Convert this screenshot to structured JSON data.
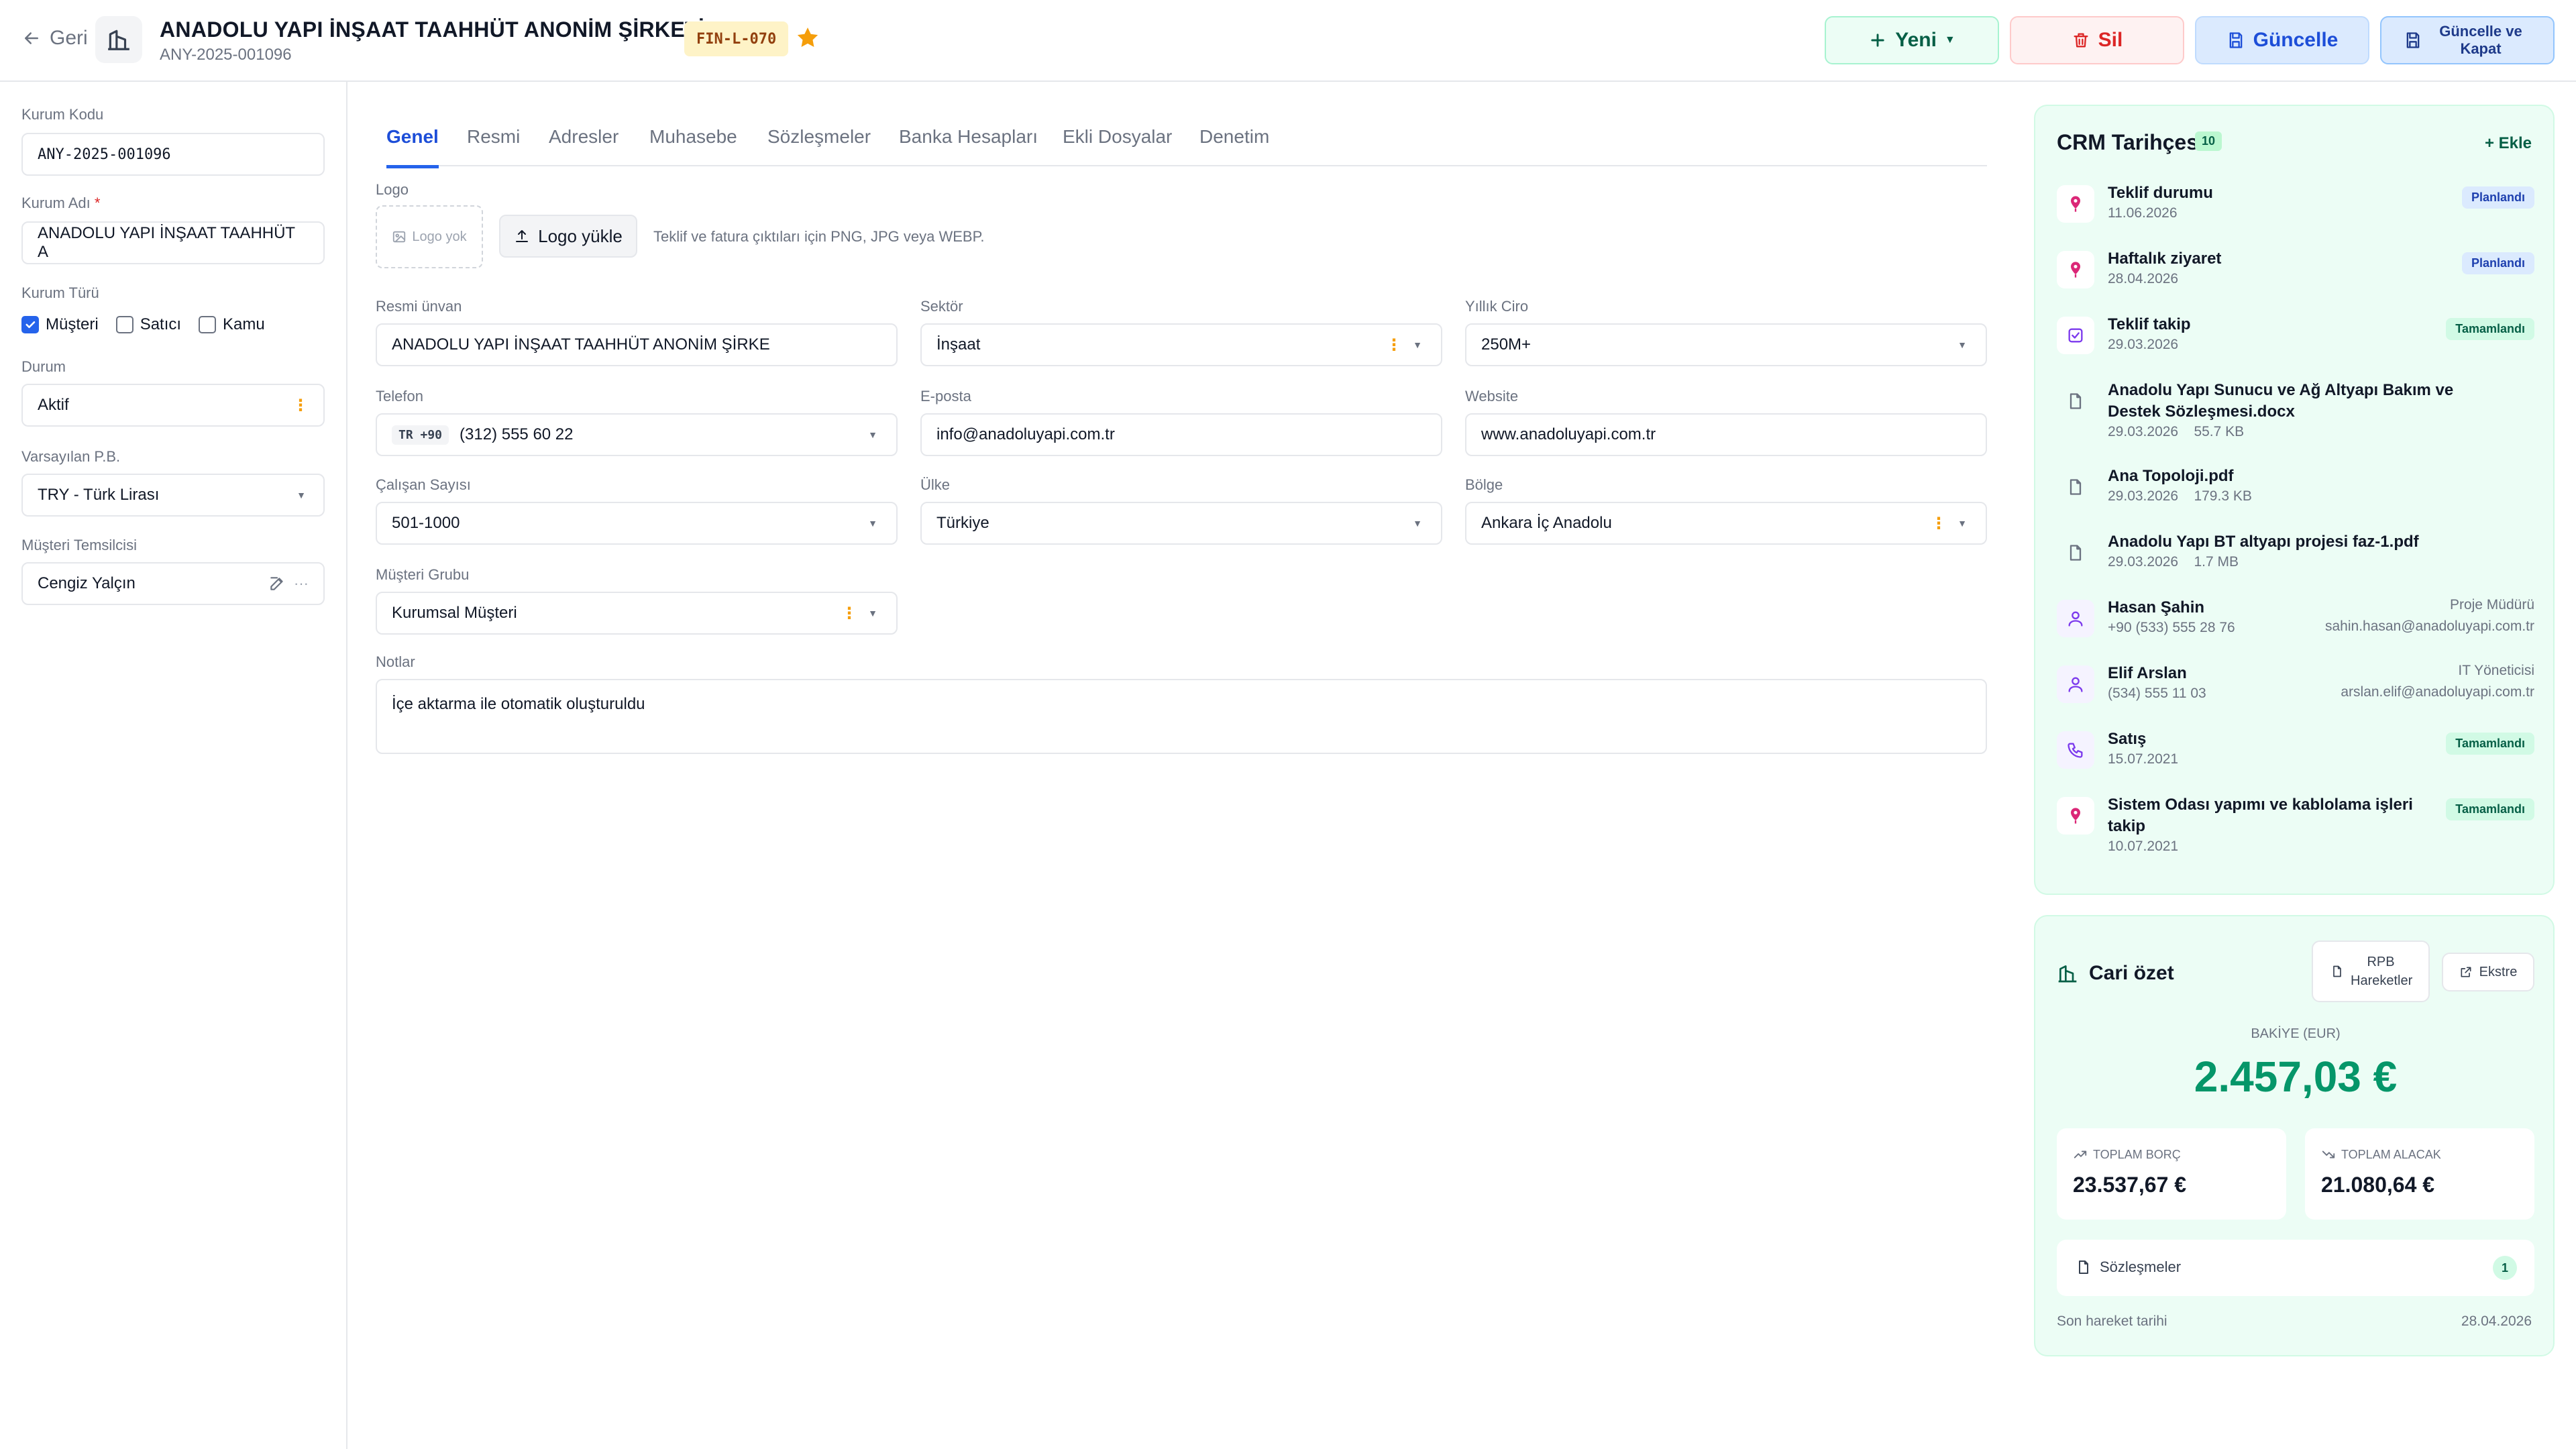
{
  "header": {
    "back_label": "Geri",
    "title": "ANADOLU YAPI İNŞAAT TAAHHÜT ANONİM ŞİRKETİ",
    "subtitle": "ANY-2025-001096",
    "code_badge": "FIN-L-070",
    "favorite": true,
    "actions": {
      "new": "Yeni",
      "delete": "Sil",
      "update": "Güncelle",
      "update_close": "Güncelle ve Kapat"
    }
  },
  "sidebar": {
    "org_code": {
      "label": "Kurum Kodu",
      "value": "ANY-2025-001096"
    },
    "org_name": {
      "label": "Kurum Adı",
      "required_mark": "*",
      "value": "ANADOLU YAPI İNŞAAT TAAHHÜT A"
    },
    "org_type": {
      "label": "Kurum Türü",
      "options": [
        {
          "label": "Müşteri",
          "checked": true
        },
        {
          "label": "Satıcı",
          "checked": false
        },
        {
          "label": "Kamu",
          "checked": false
        }
      ]
    },
    "status": {
      "label": "Durum",
      "value": "Aktif"
    },
    "currency": {
      "label": "Varsayılan P.B.",
      "value": "TRY - Türk Lirası"
    },
    "rep": {
      "label": "Müşteri Temsilcisi",
      "value": "Cengiz Yalçın"
    }
  },
  "tabs": [
    "Genel",
    "Resmi",
    "Adresler",
    "Muhasebe",
    "Sözleşmeler",
    "Banka Hesapları",
    "Ekli Dosyalar",
    "Denetim"
  ],
  "active_tab": "Genel",
  "form": {
    "logo": {
      "label": "Logo",
      "empty_text": "Logo yok",
      "upload_label": "Logo yükle",
      "hint": "Teklif ve fatura çıktıları için PNG, JPG veya WEBP."
    },
    "legal_name": {
      "label": "Resmi ünvan",
      "value": "ANADOLU YAPI İNŞAAT TAAHHÜT ANONİM ŞİRKE"
    },
    "sector": {
      "label": "Sektör",
      "value": "İnşaat"
    },
    "revenue": {
      "label": "Yıllık Ciro",
      "value": "250M+"
    },
    "phone": {
      "label": "Telefon",
      "country": "TR +90",
      "value": "(312) 555 60 22"
    },
    "email": {
      "label": "E-posta",
      "value": "info@anadoluyapi.com.tr"
    },
    "website": {
      "label": "Website",
      "value": "www.anadoluyapi.com.tr"
    },
    "employees": {
      "label": "Çalışan Sayısı",
      "value": "501-1000"
    },
    "country": {
      "label": "Ülke",
      "value": "Türkiye"
    },
    "region": {
      "label": "Bölge",
      "value": "Ankara İç Anadolu"
    },
    "customer_group": {
      "label": "Müşteri Grubu",
      "value": "Kurumsal Müşteri"
    },
    "notes": {
      "label": "Notlar",
      "value": "İçe aktarma ile otomatik oluşturuldu"
    }
  },
  "crm": {
    "title": "CRM Tarihçesi",
    "count": "10",
    "add_label": "+ Ekle",
    "items": [
      {
        "icon": "map-pin-icon",
        "title": "Teklif durumu",
        "sub": "11.06.2026",
        "badge": "Planlandı",
        "badge_type": "plan"
      },
      {
        "icon": "map-pin-icon",
        "title": "Haftalık ziyaret",
        "sub": "28.04.2026",
        "badge": "Planlandı",
        "badge_type": "plan"
      },
      {
        "icon": "task-check-icon",
        "title": "Teklif takip",
        "sub": "29.03.2026",
        "badge": "Tamamlandı",
        "badge_type": "done"
      },
      {
        "icon": "file-icon",
        "title": "Anadolu Yapı Sunucu ve Ağ Altyapı Bakım ve Destek Sözleşmesi.docx",
        "sub": "29.03.2026    55.7 KB"
      },
      {
        "icon": "file-icon",
        "title": "Ana Topoloji.pdf",
        "sub": "29.03.2026    179.3 KB"
      },
      {
        "icon": "file-icon",
        "title": "Anadolu Yapı BT altyapı projesi faz-1.pdf",
        "sub": "29.03.2026    1.7 MB"
      },
      {
        "icon": "user-icon",
        "title": "Hasan Şahin",
        "sub": "+90 (533) 555 28 76",
        "role": "Proje Müdürü",
        "mail": "sahin.hasan@anadoluyapi.com.tr"
      },
      {
        "icon": "user-icon",
        "title": "Elif Arslan",
        "sub": "(534) 555 11 03",
        "role": "IT Yöneticisi",
        "mail": "arslan.elif@anadoluyapi.com.tr"
      },
      {
        "icon": "phone-icon",
        "title": "Satış",
        "sub": "15.07.2021",
        "badge": "Tamamlandı",
        "badge_type": "done"
      },
      {
        "icon": "map-pin-icon",
        "title": "Sistem Odası yapımı ve kablolama işleri takip",
        "sub": "10.07.2021",
        "badge": "Tamamlandı",
        "badge_type": "done"
      }
    ]
  },
  "cari": {
    "title": "Cari özet",
    "rpb_label": "RPB Hareketler",
    "ekstre_label": "Ekstre",
    "balance_label": "BAKİYE (EUR)",
    "balance_value": "2.457,03 €",
    "total_debt_label": "TOPLAM BORÇ",
    "total_debt_value": "23.537,67 €",
    "total_credit_label": "TOPLAM ALACAK",
    "total_credit_value": "21.080,64 €",
    "contracts_label": "Sözleşmeler",
    "contracts_count": "1",
    "last_move_label": "Son hareket tarihi",
    "last_move_date": "28.04.2026"
  },
  "colors": {
    "accent": "#2563eb",
    "success": "#059669",
    "danger": "#dc2626",
    "warning": "#f59e0b",
    "panel_bg": "#ecfdf5"
  }
}
